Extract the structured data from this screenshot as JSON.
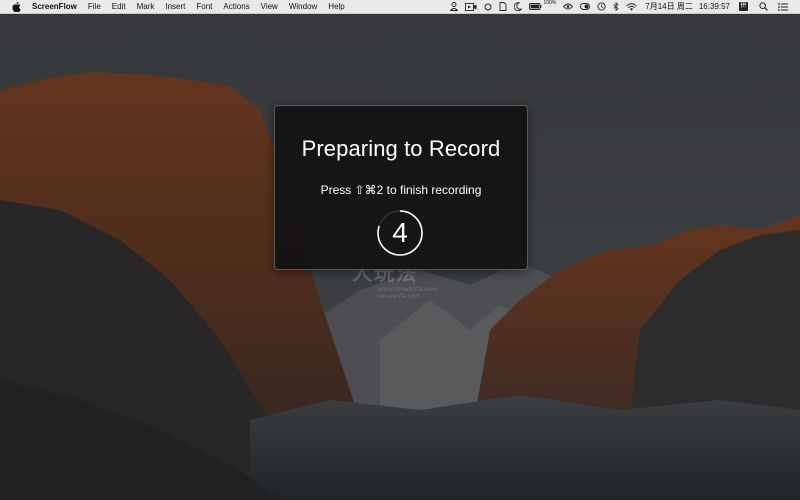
{
  "menubar": {
    "app_name": "ScreenFlow",
    "menus": [
      "File",
      "Edit",
      "Mark",
      "Insert",
      "Font",
      "Actions",
      "View",
      "Window",
      "Help"
    ],
    "status": {
      "battery_percent": "100%",
      "date": "7月14日 周二",
      "time": "16:39:57",
      "input_method": "拼"
    },
    "icons": [
      "apple-icon",
      "person-icon",
      "screen-record-icon",
      "circle-icon",
      "document-icon",
      "moon-icon",
      "battery-icon",
      "eye-icon",
      "toggle-icon",
      "time-machine-icon",
      "bluetooth-icon",
      "wifi-icon",
      "spotlight-icon",
      "notification-center-icon"
    ]
  },
  "overlay": {
    "title": "Preparing to Record",
    "hint": "Press ⇧⌘2 to finish recording",
    "countdown": "4",
    "countdown_progress": 0.8
  },
  "watermark": {
    "text": "人玩法",
    "lines": [
      "www.renwanfa.com",
      "renwanfa.com"
    ]
  }
}
